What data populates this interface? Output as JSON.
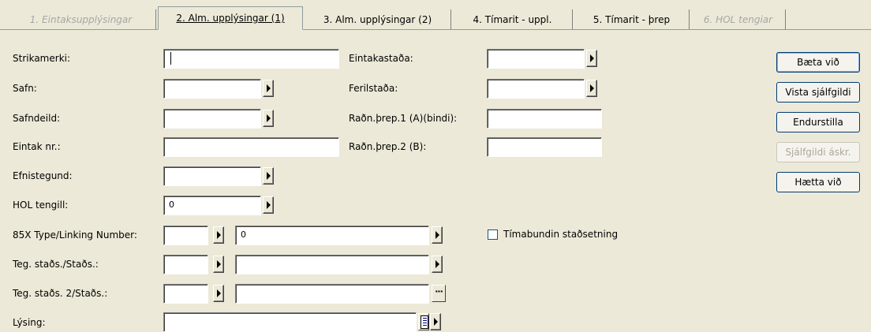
{
  "tabs": [
    {
      "label": "1. Eintaksupplýsingar",
      "state": "disabled"
    },
    {
      "label": "2. Alm. upplýsingar (1)",
      "state": "active"
    },
    {
      "label": "3. Alm. upplýsingar (2)",
      "state": "normal"
    },
    {
      "label": "4. Tímarit - uppl.",
      "state": "normal"
    },
    {
      "label": "5. Tímarit - þrep",
      "state": "normal"
    },
    {
      "label": "6. HOL tengiar",
      "state": "disabled"
    }
  ],
  "left": {
    "strikamerki_label": "Strikamerki:",
    "strikamerki_value": "",
    "safn_label": "Safn:",
    "safn_value": "",
    "safndeild_label": "Safndeild:",
    "safndeild_value": "",
    "eintak_label": "Eintak nr.:",
    "eintak_value": "",
    "efnistegund_label": "Efnistegund:",
    "efnistegund_value": "",
    "hol_label": "HOL tengill:",
    "hol_value": "0",
    "x85_label": "85X Type/Linking Number:",
    "x85_type_value": "",
    "x85_number_value": "0",
    "teg1_label": "Teg. staðs./Staðs.:",
    "teg1_type_value": "",
    "teg1_value": "",
    "teg2_label": "Teg. staðs. 2/Staðs.:",
    "teg2_type_value": "",
    "teg2_value": "",
    "lysing_label": "Lýsing:",
    "lysing_value": ""
  },
  "middle": {
    "eintakastada_label": "Eintakastaða:",
    "eintakastada_value": "",
    "ferilstada_label": "Ferilstaða:",
    "ferilstada_value": "",
    "radn1_label": "Raðn.þrep.1 (A)(bindi):",
    "radn1_value": "",
    "radn2_label": "Raðn.þrep.2 (B):",
    "radn2_value": "",
    "timabundin_label": "Tímabundin staðsetning",
    "timabundin_checked": false
  },
  "buttons": {
    "add": "Bæta við",
    "show_default": "Vista sjálfgildi",
    "reset": "Endurstilla",
    "default_req": "Sjálfgildi áskr.",
    "cancel": "Hætta við"
  }
}
